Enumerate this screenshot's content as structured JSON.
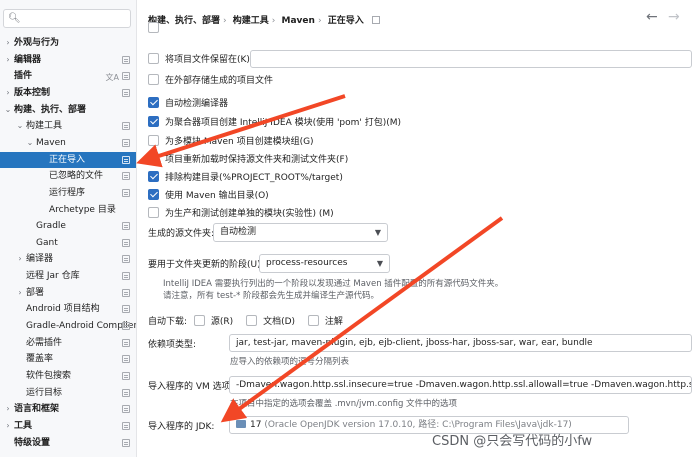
{
  "sidebar": {
    "search": {
      "placeholder": ""
    },
    "items": [
      {
        "label": "外观与行为",
        "level": 0,
        "arrow": "›",
        "bold": true
      },
      {
        "label": "编辑器",
        "level": 0,
        "arrow": "›",
        "bold": true
      },
      {
        "label": "插件",
        "level": 0,
        "arrow": "",
        "bold": true
      },
      {
        "label": "版本控制",
        "level": 0,
        "arrow": "›",
        "bold": true
      },
      {
        "label": "构建、执行、部署",
        "level": 0,
        "arrow": "⌄",
        "bold": true
      },
      {
        "label": "构建工具",
        "level": 1,
        "arrow": "⌄"
      },
      {
        "label": "Maven",
        "level": 2,
        "arrow": "⌄"
      },
      {
        "label": "正在导入",
        "level": 3,
        "arrow": "",
        "selected": true
      },
      {
        "label": "已忽略的文件",
        "level": 3,
        "arrow": ""
      },
      {
        "label": "运行程序",
        "level": 3,
        "arrow": ""
      },
      {
        "label": "Archetype 目录",
        "level": 3,
        "arrow": ""
      },
      {
        "label": "Gradle",
        "level": 2,
        "arrow": ""
      },
      {
        "label": "Gant",
        "level": 2,
        "arrow": ""
      },
      {
        "label": "编译器",
        "level": 1,
        "arrow": "›"
      },
      {
        "label": "远程 Jar 仓库",
        "level": 1,
        "arrow": ""
      },
      {
        "label": "部署",
        "level": 1,
        "arrow": "›"
      },
      {
        "label": "Android 项目结构",
        "level": 1,
        "arrow": ""
      },
      {
        "label": "Gradle-Android Compiler",
        "level": 1,
        "arrow": ""
      },
      {
        "label": "必需插件",
        "level": 1,
        "arrow": ""
      },
      {
        "label": "覆盖率",
        "level": 1,
        "arrow": ""
      },
      {
        "label": "软件包搜索",
        "level": 1,
        "arrow": ""
      },
      {
        "label": "运行目标",
        "level": 1,
        "arrow": ""
      },
      {
        "label": "语言和框架",
        "level": 0,
        "arrow": "›",
        "bold": true
      },
      {
        "label": "工具",
        "level": 0,
        "arrow": "›",
        "bold": true
      },
      {
        "label": "特级设置",
        "level": 0,
        "arrow": "",
        "bold": true
      }
    ]
  },
  "breadcrumb": [
    "构建、执行、部署",
    "构建工具",
    "Maven",
    "正在导入"
  ],
  "options": {
    "save_project_files": "将项目文件保留在(K):",
    "store_external": "在外部存储生成的项目文件",
    "auto_detect_compiler": "自动检测编译器",
    "create_intellij_modules": "为聚合器项目创建 IntelliJ IDEA 模块(使用 'pom' 打包)(M)",
    "create_module_groups": "为多模块 Maven 项目创建模块组(G)",
    "keep_source_folders": "项目重新加载时保持源文件夹和测试文件夹(F)",
    "exclude_build_dir": "排除构建目录(%PROJECT_ROOT%/target)",
    "use_maven_output": "使用 Maven 输出目录(O)",
    "separate_modules": "为生产和测试创建单独的模块(实验性) (M)"
  },
  "generated_sources": {
    "label": "生成的源文件夹:",
    "value": "自动检测"
  },
  "phase": {
    "label": "要用于文件夹更新的阶段(U):",
    "value": "process-resources",
    "hint1": "IntelliJ IDEA 需要执行列出的一个阶段以发现通过 Maven 插件配置的所有源代码文件夹。",
    "hint2": "请注意，所有 test-* 阶段都会先生成并编译生产源代码。"
  },
  "auto_download": {
    "label": "自动下载:",
    "sources": "源(R)",
    "docs": "文档(D)",
    "annotations": "注解"
  },
  "dependency_types": {
    "label": "依赖项类型:",
    "value": "jar, test-jar, maven-plugin, ejb, ejb-client, jboss-har, jboss-sar, war, ear, bundle",
    "hint": "应导入的依赖项的逗号分隔列表"
  },
  "vm_options": {
    "label": "导入程序的 VM 选项:",
    "value": "-Dmaven.wagon.http.ssl.insecure=true -Dmaven.wagon.http.ssl.allowall=true -Dmaven.wagon.http.ssl.ignore.validity.d",
    "hint": "在项目中指定的选项会覆盖 .mvn/jvm.config 文件中的选项"
  },
  "jdk": {
    "label": "导入程序的 JDK:",
    "version": "17",
    "detail": "(Oracle OpenJDK version 17.0.10, 路径: C:\\Program Files\\Java\\jdk-17)"
  },
  "watermark": "CSDN @只会写代码的小fw",
  "colors": {
    "accent": "#2675bf",
    "arrow": "#f24726",
    "checkbox": "#2d6ec1"
  }
}
